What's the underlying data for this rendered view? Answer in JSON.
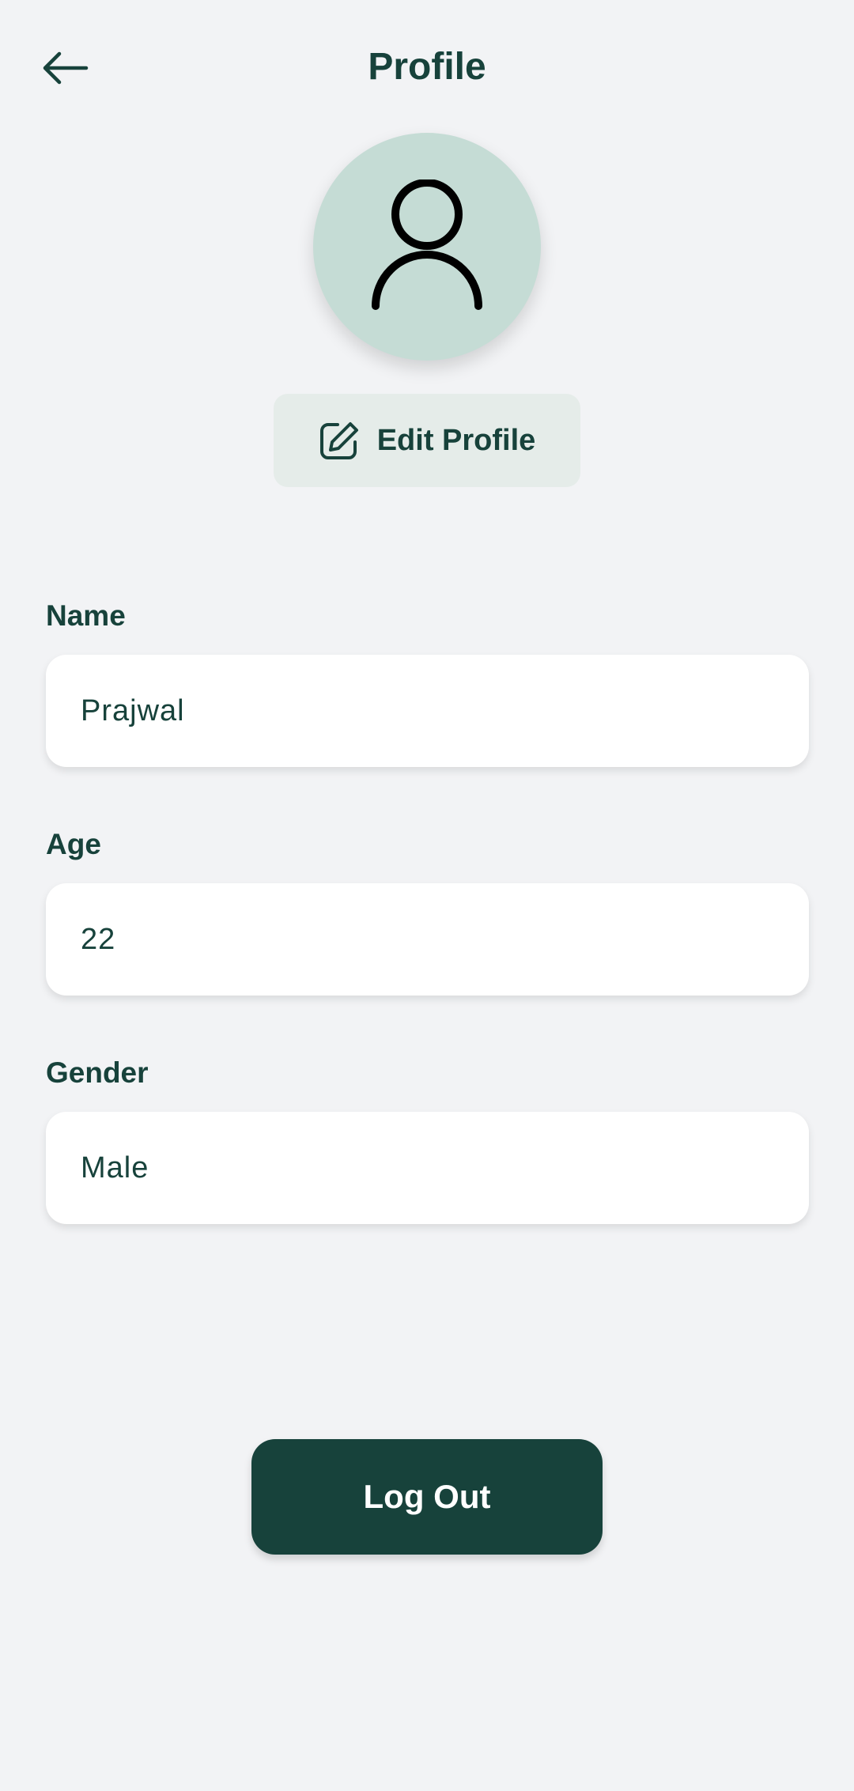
{
  "header": {
    "title": "Profile",
    "back_icon": "arrow-left-icon"
  },
  "avatar": {
    "icon": "user-icon",
    "background": "#c5dcd5"
  },
  "edit_profile": {
    "label": "Edit Profile",
    "icon": "edit-icon"
  },
  "fields": [
    {
      "label": "Name",
      "value": "Prajwal"
    },
    {
      "label": "Age",
      "value": "22"
    },
    {
      "label": "Gender",
      "value": "Male"
    }
  ],
  "logout": {
    "label": "Log Out"
  },
  "colors": {
    "primary": "#17423b",
    "background": "#f2f3f5",
    "card": "#ffffff"
  }
}
